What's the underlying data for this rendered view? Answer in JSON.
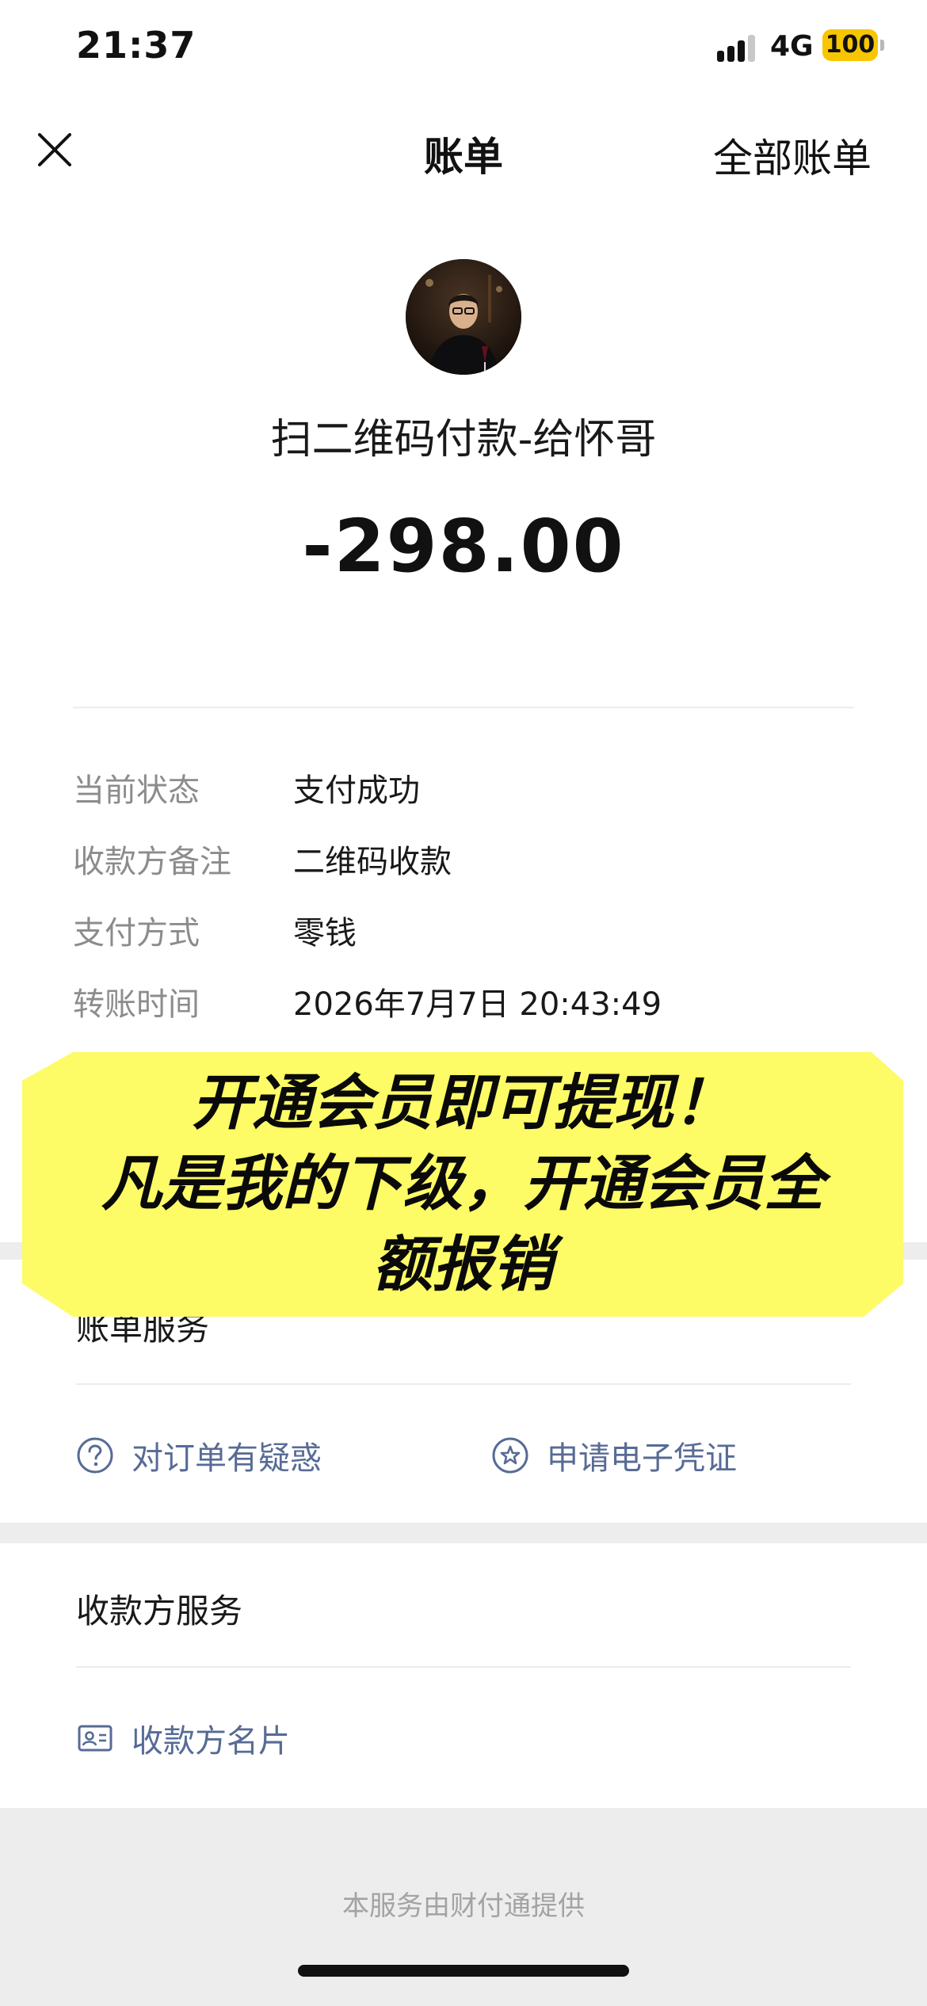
{
  "status_bar": {
    "time": "21:37",
    "network": "4G",
    "battery": "100",
    "battery_color": "#f7c600"
  },
  "nav": {
    "close_icon": "close-icon",
    "title": "账单",
    "right_link": "全部账单"
  },
  "transaction": {
    "merchant": "扫二维码付款-给怀哥",
    "amount": "-298.00"
  },
  "details": [
    {
      "label": "当前状态",
      "value": "支付成功"
    },
    {
      "label": "收款方备注",
      "value": "二维码收款"
    },
    {
      "label": "支付方式",
      "value": "零钱"
    },
    {
      "label": "转账时间",
      "value": "2026年7月7日 20:43:49"
    }
  ],
  "promo": {
    "line1": "开通会员即可提现！",
    "line2": "凡是我的下级，开通会员全",
    "line3": "额报销",
    "bg_color": "#fdfb66"
  },
  "bill_service": {
    "title": "账单服务",
    "items": [
      {
        "label": "对订单有疑惑",
        "icon": "question-circle-icon"
      },
      {
        "label": "申请电子凭证",
        "icon": "star-circle-icon"
      }
    ]
  },
  "payee_service": {
    "title": "收款方服务",
    "items": [
      {
        "label": "收款方名片",
        "icon": "contact-card-icon"
      }
    ]
  },
  "footer": {
    "text": "本服务由财付通提供"
  },
  "colors": {
    "link_blue": "#576b95",
    "label_gray": "#8c8c8c",
    "band_gray": "#ededed"
  }
}
